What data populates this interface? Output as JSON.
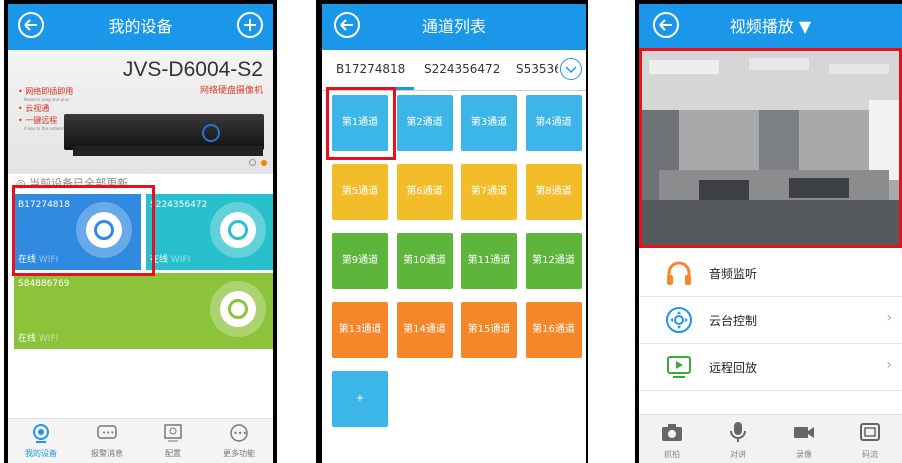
{
  "phone1": {
    "title": "我的设备",
    "banner": {
      "model": "JVS-D6004-S2",
      "subtitle": "网络硬盘摄像机",
      "bullets": [
        "网络即插即用",
        "云视通",
        "一键远程"
      ],
      "bullet_small": [
        "Network plug and play",
        "",
        "A key to the network"
      ]
    },
    "notice": "当前设备已全部更新",
    "devices": [
      {
        "id": "B17274818",
        "status": "在线",
        "net": "WIFI"
      },
      {
        "id": "S224356472",
        "status": "在线",
        "net": "WIFI"
      },
      {
        "id": "S84886769",
        "status": "在线",
        "net": "WIFI"
      }
    ],
    "tabs": [
      "我的设备",
      "报警消息",
      "配置",
      "更多功能"
    ]
  },
  "phone2": {
    "title": "通道列表",
    "device_tabs": [
      "B17274818",
      "S224356472",
      "S53536"
    ],
    "channels": [
      "第1通道",
      "第2通道",
      "第3通道",
      "第4通道",
      "第5通道",
      "第6通道",
      "第7通道",
      "第8通道",
      "第9通道",
      "第10通道",
      "第11通道",
      "第12通道",
      "第13通道",
      "第14通道",
      "第15通道",
      "第16通道"
    ],
    "add_label": "+"
  },
  "phone3": {
    "title": "视频播放",
    "menu": [
      "音频监听",
      "云台控制",
      "远程回放"
    ],
    "bottom": [
      "抓拍",
      "对讲",
      "录像",
      "码流"
    ]
  },
  "colors": {
    "header": "#1a97e8",
    "blue": "#3cb5e8",
    "yellow": "#f3bd2a",
    "green": "#5db53c",
    "orange": "#f5872a",
    "highlight": "#e8101a"
  }
}
